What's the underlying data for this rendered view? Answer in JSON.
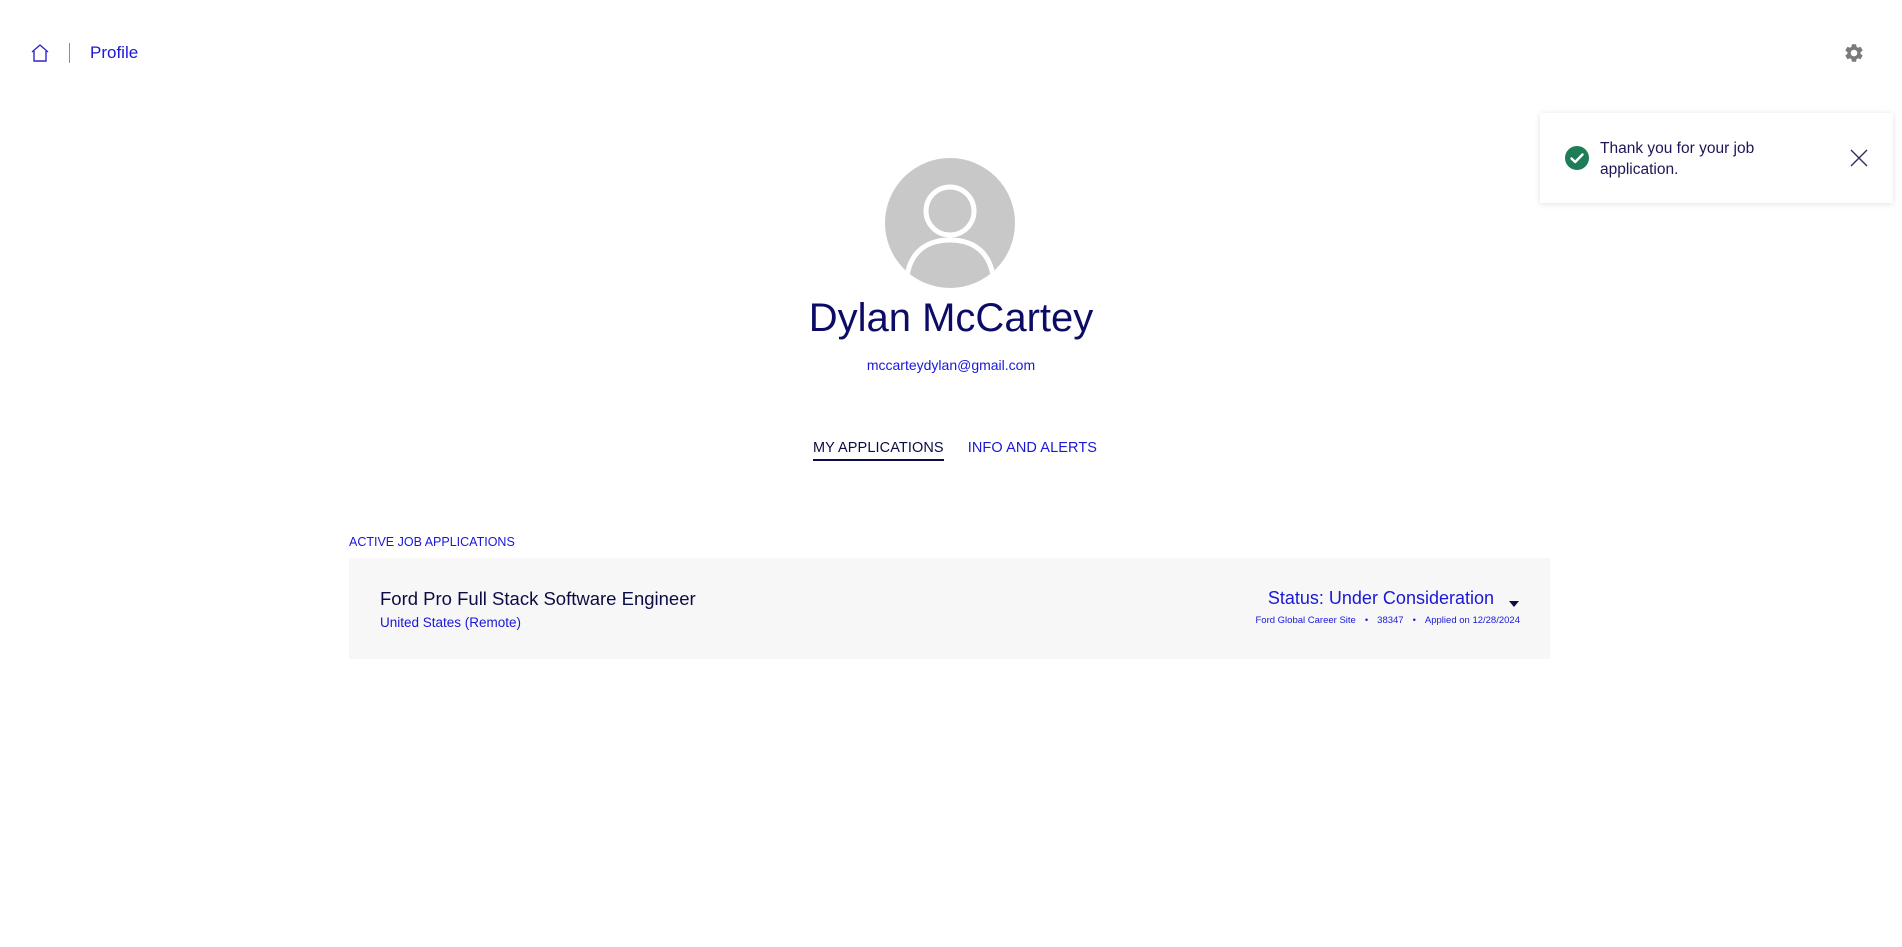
{
  "header": {
    "home_icon": "home-icon",
    "breadcrumb_label": "Profile",
    "settings_icon": "gear-icon"
  },
  "toast": {
    "message": "Thank you for your job application.",
    "status_icon": "check-circle-icon",
    "close_icon": "close-icon",
    "accent_color": "#1e7d57"
  },
  "profile": {
    "name": "Dylan McCartey",
    "email": "mccarteydylan@gmail.com",
    "avatar_icon": "user-avatar-icon"
  },
  "tabs": [
    {
      "label": "MY APPLICATIONS",
      "active": true
    },
    {
      "label": "INFO AND ALERTS",
      "active": false
    }
  ],
  "applications": {
    "section_title": "ACTIVE JOB APPLICATIONS",
    "items": [
      {
        "title": "Ford Pro Full Stack Software Engineer",
        "location": "United States (Remote)",
        "status": "Status: Under Consideration",
        "source": "Ford Global Career Site",
        "job_id": "38347",
        "applied": "Applied on 12/28/2024"
      }
    ]
  },
  "colors": {
    "link_blue": "#1a17d6",
    "heading_navy": "#0c0c66",
    "card_bg": "#f7f7f7"
  }
}
